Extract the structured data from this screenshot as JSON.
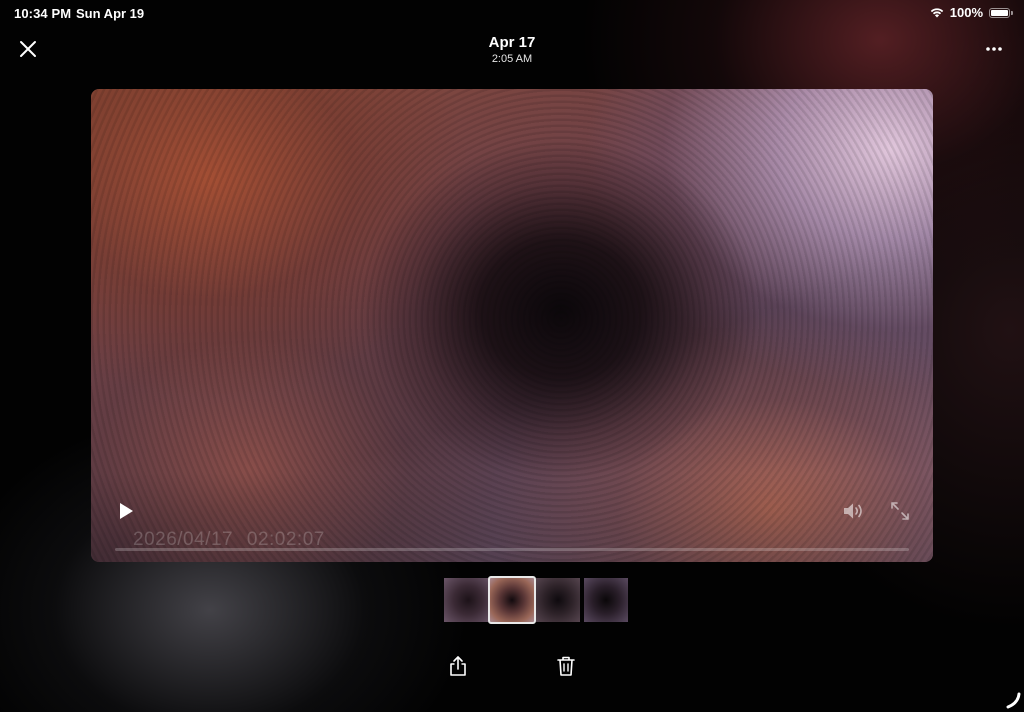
{
  "status_bar": {
    "time": "10:34 PM",
    "date": "Sun Apr 19",
    "battery_percent": "100%",
    "battery_level": 1.0,
    "icons": [
      "wifi-icon",
      "battery-icon"
    ]
  },
  "header": {
    "title": "Apr 17",
    "subtitle": "2:05 AM",
    "close_icon": "close-icon",
    "more_icon": "more-icon"
  },
  "video": {
    "timestamp": "2026/04/17   02:02:07",
    "progress": 0.0,
    "controls": [
      "play-icon",
      "volume-icon",
      "expand-icon"
    ]
  },
  "thumbnails": {
    "count": 4,
    "selected_index": 1
  },
  "actions": {
    "icons": [
      "share-icon",
      "trash-icon"
    ]
  },
  "colors": {
    "background": "#000000",
    "text": "#ffffff",
    "selection_border": "#e8e8e8"
  }
}
